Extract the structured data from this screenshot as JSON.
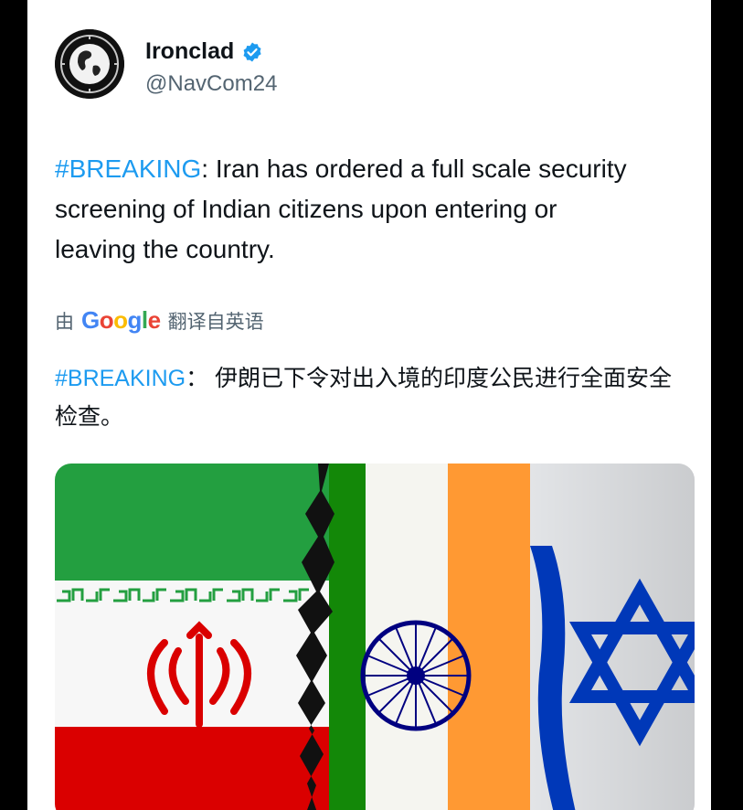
{
  "tweet": {
    "author_name": "Ironclad",
    "author_handle": "@NavCom24",
    "hashtag": "#BREAKING",
    "body": ": Iran has ordered a full scale security screening of Indian citizens upon entering or leaving the country.",
    "translation_prefix": "由",
    "translation_brand": "Google",
    "translation_suffix": "翻译自英语",
    "translated_hashtag": "#BREAKING",
    "translated_body": "： 伊朗已下令对出入境的印度公民进行全面安全检查。"
  },
  "icons": {
    "verified": "verified-badge-icon",
    "avatar": "globe-emblem-avatar"
  },
  "colors": {
    "link": "#1d9bf0",
    "text": "#0f1419",
    "muted": "#536471",
    "iran_green": "#239f40",
    "iran_red": "#da0000",
    "india_saffron": "#ff9933",
    "india_green": "#138808",
    "chakra_blue": "#000080",
    "israel_blue": "#0038b8"
  }
}
